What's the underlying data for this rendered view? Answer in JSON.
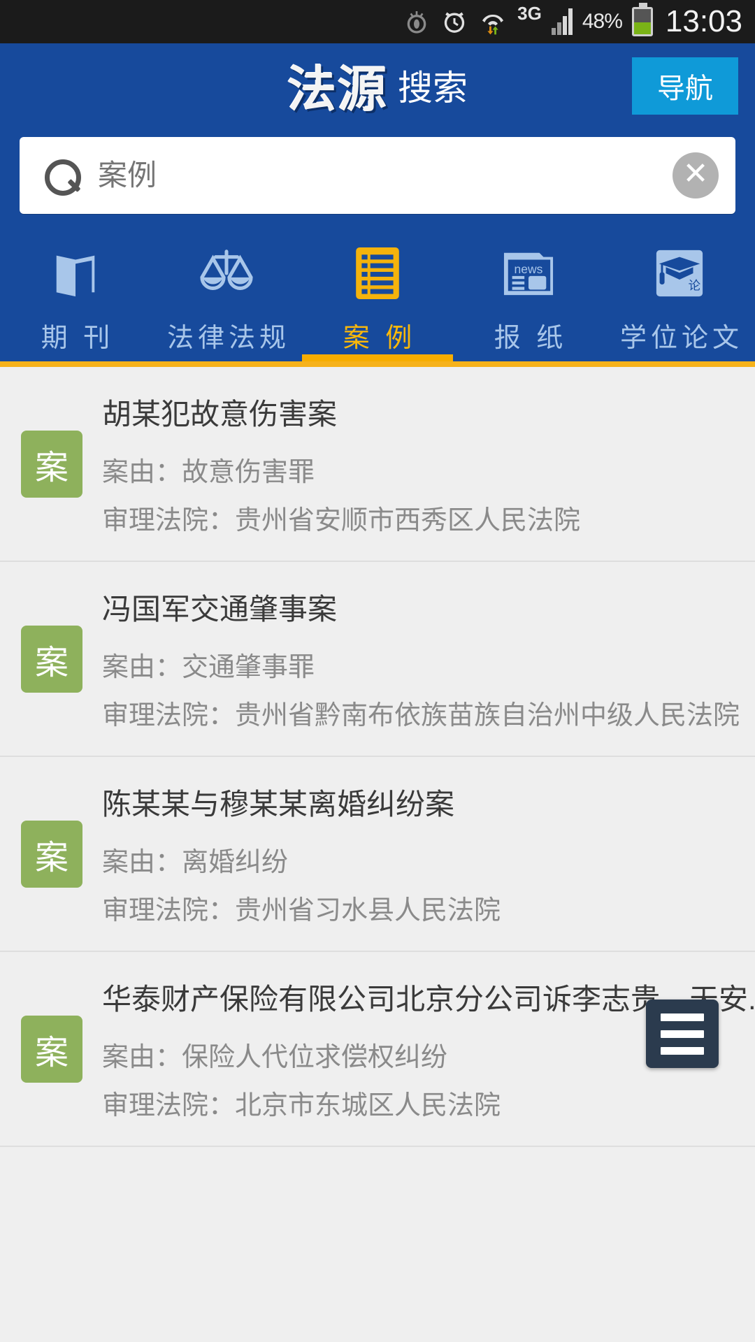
{
  "status_bar": {
    "icons": [
      "smart-stay-icon",
      "alarm-icon",
      "wifi-icon",
      "data-transfer-icon"
    ],
    "network_type": "3G",
    "battery_percent": "48%",
    "clock": "13:03"
  },
  "header": {
    "logo_main": "法源",
    "logo_sub": "搜索",
    "nav_button": "导航",
    "background_color": "#174a9c",
    "nav_button_color": "#0f9ad8"
  },
  "search": {
    "value": "",
    "placeholder": "案例",
    "search_icon": "magnifier-icon",
    "clear_icon": "clear-circle-icon",
    "clear_glyph": "✕"
  },
  "tabs": {
    "active_index": 2,
    "active_color": "#fbb80a",
    "inactive_color": "#a8c6ea",
    "items": [
      {
        "label": "期 刊",
        "icon": "book-icon"
      },
      {
        "label": "法律法规",
        "icon": "scales-of-justice-icon"
      },
      {
        "label": "案 例",
        "icon": "case-document-icon"
      },
      {
        "label": "报 纸",
        "icon": "newspaper-icon"
      },
      {
        "label": "学位论文",
        "icon": "graduation-cap-icon"
      }
    ]
  },
  "results": {
    "badge_text": "案",
    "badge_color": "#8eb15c",
    "items": [
      {
        "title": "胡某犯故意伤害案",
        "cause": "案由：故意伤害罪",
        "court": "审理法院：贵州省安顺市西秀区人民法院"
      },
      {
        "title": "冯国军交通肇事案",
        "cause": "案由：交通肇事罪",
        "court": "审理法院：贵州省黔南布依族苗族自治州中级人民法院"
      },
      {
        "title": "陈某某与穆某某离婚纠纷案",
        "cause": "案由：离婚纠纷",
        "court": "审理法院：贵州省习水县人民法院"
      },
      {
        "title": "华泰财产保险有限公司北京分公司诉李志贵、天安...",
        "cause": "案由：保险人代位求偿权纠纷",
        "court": "审理法院：北京市东城区人民法院"
      }
    ]
  },
  "fab": {
    "icon": "hamburger-menu-icon",
    "color": "#2b3b4e"
  }
}
